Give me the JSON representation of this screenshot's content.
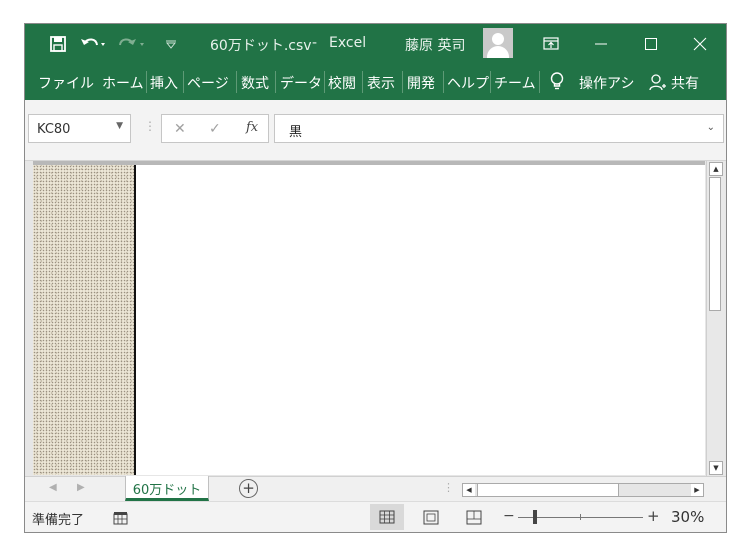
{
  "window": {
    "filename": "60万ドット.csv",
    "separator": "-",
    "app_name": "Excel",
    "user_name": "藤原 英司"
  },
  "ribbon": {
    "tabs": [
      {
        "label": "ファイル"
      },
      {
        "label": "ホーム"
      },
      {
        "label": "挿入"
      },
      {
        "label": "ページ"
      },
      {
        "label": "数式"
      },
      {
        "label": "データ"
      },
      {
        "label": "校閲"
      },
      {
        "label": "表示"
      },
      {
        "label": "開発"
      },
      {
        "label": "ヘルプ"
      },
      {
        "label": "チーム"
      }
    ],
    "tell_me": "操作アシ",
    "share": "共有"
  },
  "formula_bar": {
    "name_box": "KC80",
    "fx": "fx",
    "value": "黒"
  },
  "sheet": {
    "tab_name": "60万ドット"
  },
  "status_bar": {
    "ready": "準備完了",
    "zoom": "30%",
    "zoom_minus": "−",
    "zoom_plus": "+"
  },
  "colors": {
    "accent": "#217346"
  }
}
